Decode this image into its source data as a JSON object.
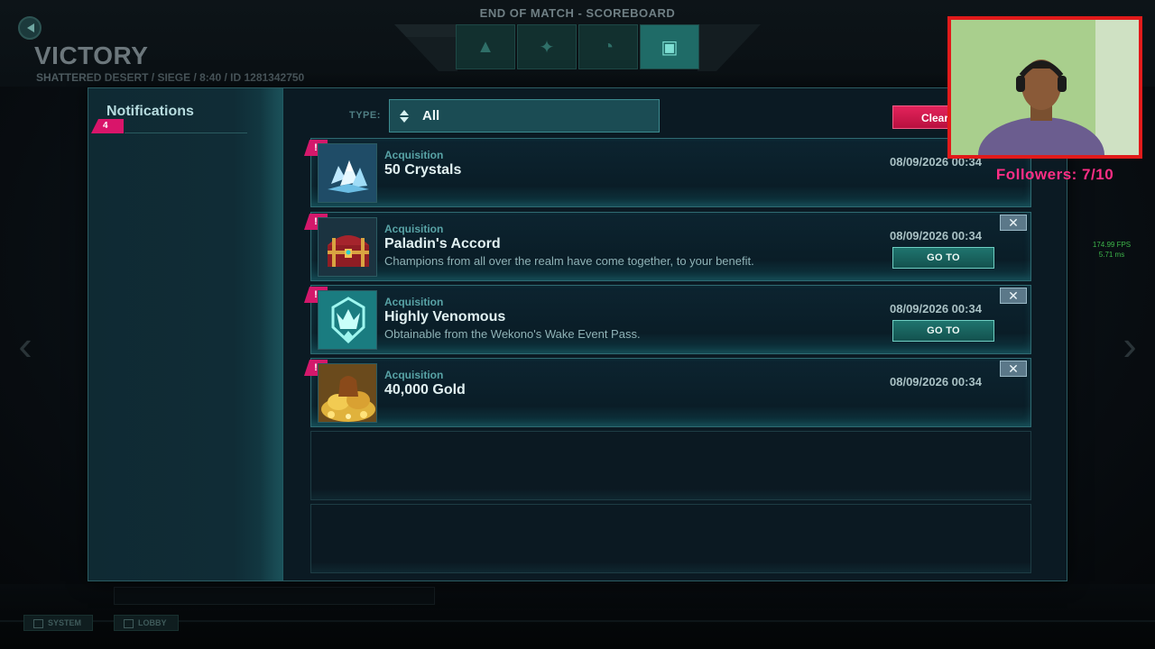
{
  "background": {
    "screen_title": "END OF MATCH - SCOREBOARD",
    "result": "VICTORY",
    "match_info": "SHATTERED DESERT / SIEGE / 8:40 / ID 1281342750",
    "bottom_buttons": [
      "SYSTEM",
      "LOBBY"
    ],
    "fps_text": "174.99 FPS",
    "ms_text": "5.71 ms"
  },
  "sidebar": {
    "title": "Notifications",
    "count": "4"
  },
  "filter": {
    "label": "TYPE:",
    "value": "All",
    "clear_label": "Clear"
  },
  "notifications": [
    {
      "badge": "!",
      "category": "Acquisition",
      "title": "50 Crystals",
      "description": "",
      "date": "08/09/2026 00:34",
      "icon": "crystals-icon",
      "has_close": false,
      "has_goto": false
    },
    {
      "badge": "!",
      "category": "Acquisition",
      "title": "Paladin's Accord",
      "description": "Champions from all over the realm have come together, to your benefit.",
      "date": "08/09/2026 00:34",
      "icon": "treasure-chest-icon",
      "has_close": true,
      "has_goto": true,
      "goto_label": "GO TO"
    },
    {
      "badge": "!",
      "category": "Acquisition",
      "title": "Highly Venomous",
      "description": "Obtainable from the Wekono's Wake Event Pass.",
      "date": "08/09/2026 00:34",
      "icon": "crown-emblem-icon",
      "has_close": true,
      "has_goto": true,
      "goto_label": "GO TO"
    },
    {
      "badge": "!",
      "category": "Acquisition",
      "title": "40,000 Gold",
      "description": "",
      "date": "08/09/2026 00:34",
      "icon": "gold-pile-icon",
      "has_close": true,
      "has_goto": false
    }
  ],
  "close_glyph": "✕",
  "overlay": {
    "followers": "Followers: 7/10"
  }
}
